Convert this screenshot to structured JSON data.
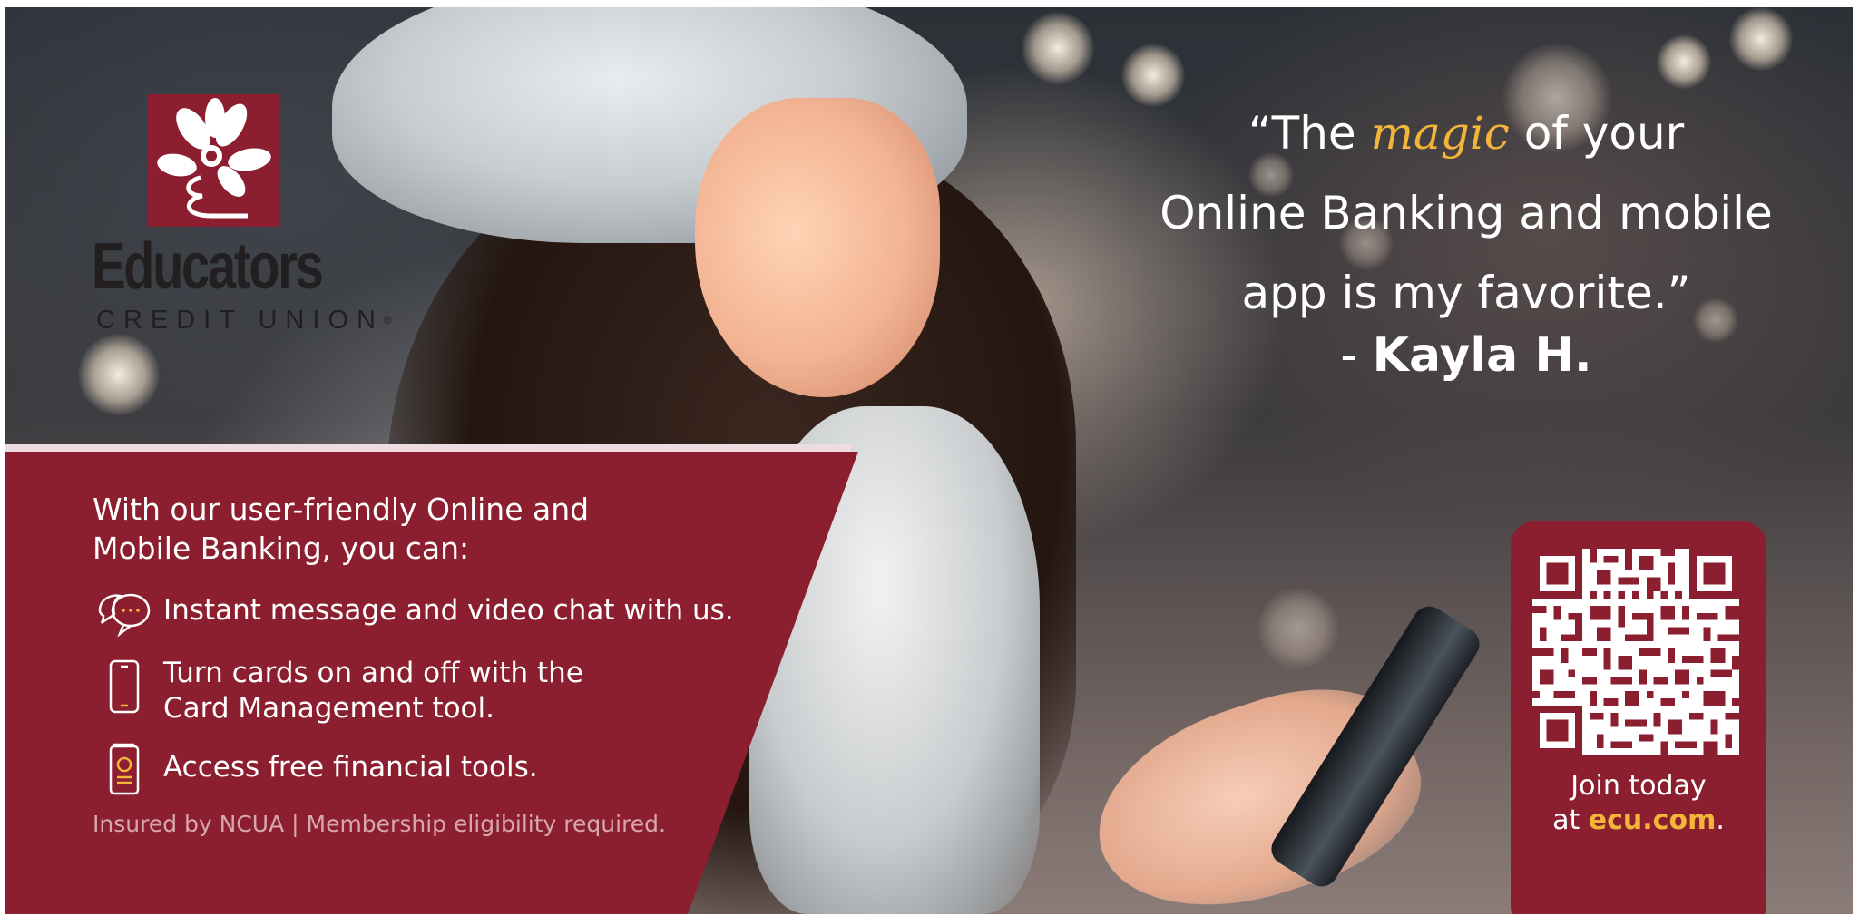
{
  "brand": {
    "name": "Educators",
    "subtitle": "CREDIT UNION",
    "registered_mark": "®",
    "color": "#8b1e2f"
  },
  "quote": {
    "open_mark": "“The",
    "highlight": "magic",
    "line1_rest": "of your",
    "line2": "Online Banking and mobile",
    "line3": "app is my favorite.”",
    "author_prefix": "-",
    "author": "Kayla H.",
    "highlight_color": "#f2b53a"
  },
  "panel": {
    "intro_line1": "With our user-friendly Online and",
    "intro_line2": "Mobile Banking, you can:",
    "features": [
      {
        "icon": "chat-bubbles-icon",
        "line1": "Instant message and video chat with us.",
        "line2": ""
      },
      {
        "icon": "smartphone-icon",
        "line1": "Turn cards on and off with the",
        "line2": "Card Management tool."
      },
      {
        "icon": "financial-tools-icon",
        "line1": "Access free financial tools.",
        "line2": ""
      }
    ],
    "disclaimer": "Insured by NCUA | Membership eligibility required."
  },
  "cta": {
    "qr_icon": "qr-code-icon",
    "join_line1": "Join today",
    "join_prefix": "at",
    "url": "ecu.com",
    "join_suffix": "."
  }
}
